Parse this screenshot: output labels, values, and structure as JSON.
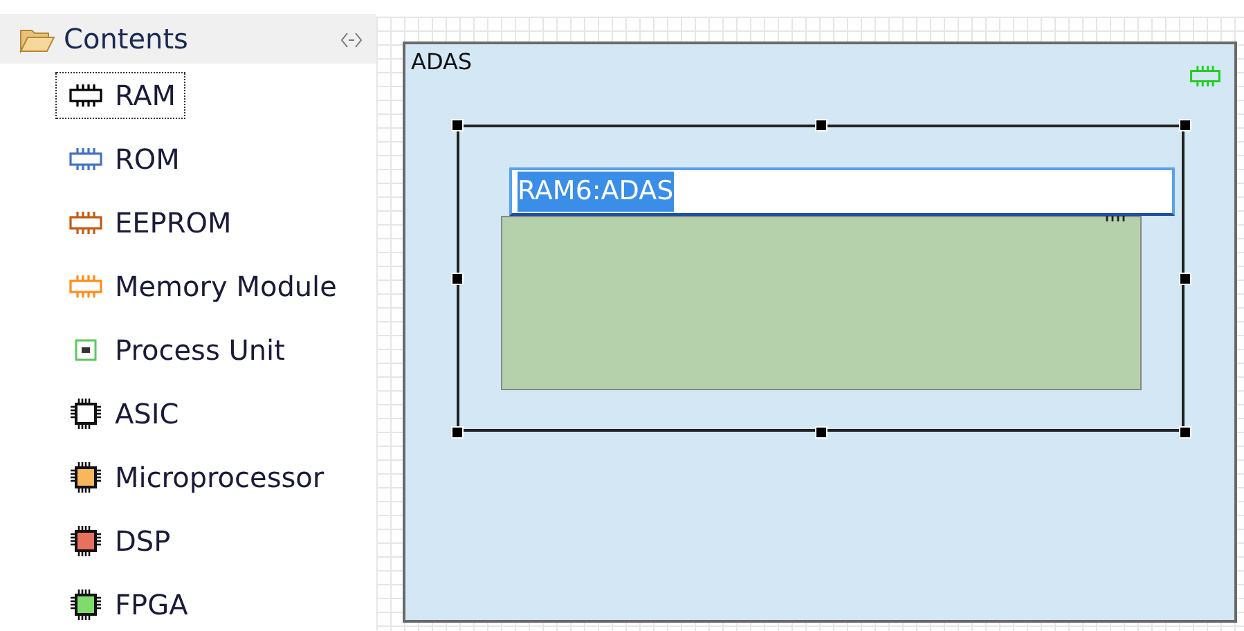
{
  "palette": {
    "title": "Contents",
    "items": [
      {
        "label": "RAM",
        "kind": "memory",
        "color": "#000000",
        "selected": true
      },
      {
        "label": "ROM",
        "kind": "memory",
        "color": "#4472c4",
        "selected": false
      },
      {
        "label": "EEPROM",
        "kind": "memory",
        "color": "#c55a11",
        "selected": false
      },
      {
        "label": "Memory Module",
        "kind": "memory",
        "color": "#ff8c1a",
        "selected": false
      },
      {
        "label": "Process Unit",
        "kind": "unit",
        "color": "#5cc85c",
        "selected": false
      },
      {
        "label": "ASIC",
        "kind": "processor",
        "color": "#ffffff",
        "selected": false
      },
      {
        "label": "Microprocessor",
        "kind": "processor",
        "color": "#f7b75a",
        "selected": false
      },
      {
        "label": "DSP",
        "kind": "processor",
        "color": "#e8705e",
        "selected": false
      },
      {
        "label": "FPGA",
        "kind": "processor",
        "color": "#7fdc6a",
        "selected": false
      }
    ]
  },
  "diagram": {
    "block": {
      "title": "ADAS",
      "part": {
        "selected": true,
        "name_editor": {
          "value": "RAM6:ADAS",
          "text_selected": true
        }
      }
    }
  }
}
